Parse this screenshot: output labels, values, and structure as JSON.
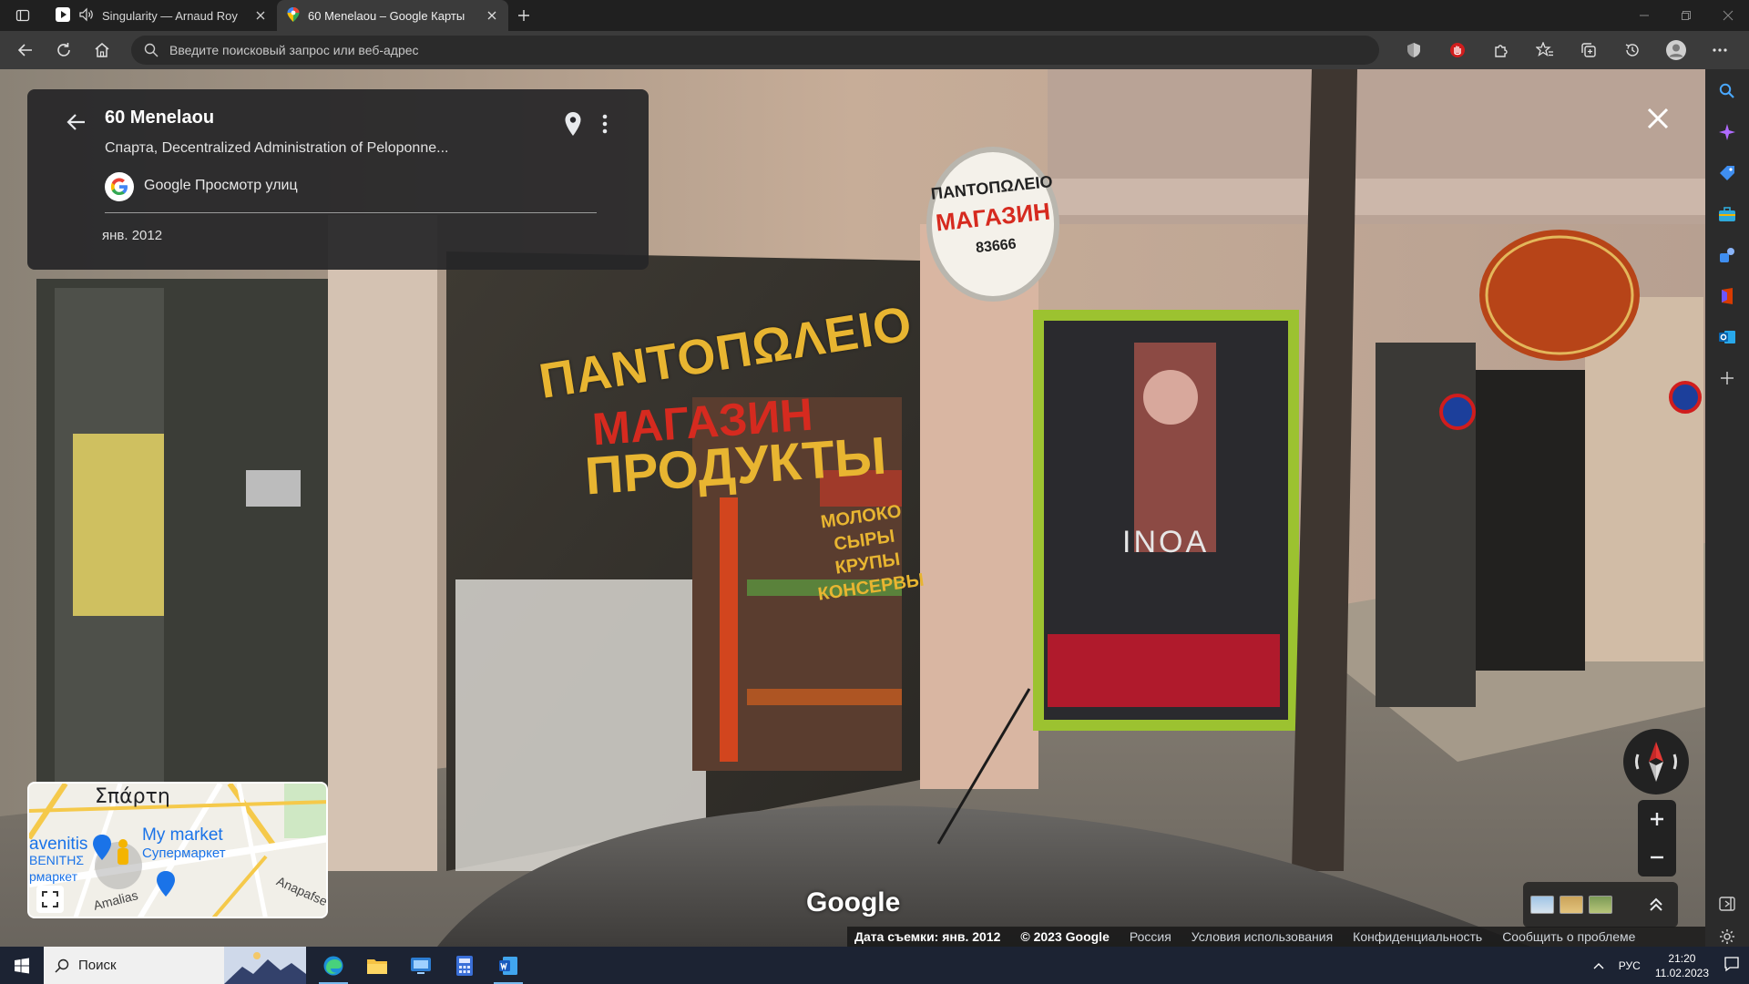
{
  "browser": {
    "tabs": [
      {
        "title": "Singularity — Arnaud Roy",
        "icon": "youtube-music-icon",
        "audio": true,
        "active": false
      },
      {
        "title": "60 Menelaou – Google Карты",
        "icon": "google-maps-icon",
        "audio": false,
        "active": true
      }
    ],
    "address_placeholder": "Введите поисковый запрос или веб-адрес"
  },
  "street_view": {
    "place_title": "60 Menelaou",
    "place_subtitle": "Спарта, Decentralized Administration of Peloponne...",
    "source_label": "Google Просмотр улиц",
    "capture_date": "янв. 2012",
    "watermark": "Google",
    "footer": {
      "capture": "Дата съемки: янв. 2012",
      "copyright": "© 2023 Google",
      "links": [
        "Россия",
        "Условия использования",
        "Конфиденциальность",
        "Сообщить о проблеме"
      ]
    },
    "minimap": {
      "city": "Σπάρτη",
      "poi": "My market",
      "poi_sub": "Супермаркет",
      "poi_left": "avenitis",
      "poi_left2": "ΒΕΝΙΤΗΣ",
      "poi_left3": "рмаркет",
      "street1": "Amalias",
      "street2": "Anapafse"
    },
    "signs": {
      "window_line1": "ΠΑΝΤΟΠΩΛΕΙΟ",
      "window_line2": "МАГАЗИН",
      "window_line3": "ПРОДУКТЫ",
      "side_line1": "МОЛОКО",
      "side_line2": "СЫРЫ",
      "side_line3": "КРУПЫ",
      "side_line4": "КОНСЕРВЫ",
      "oval_line1": "ΠΑΝΤΟΠΩΛΕΙΟ",
      "oval_line2": "МАГАЗИН",
      "oval_line3": "83666",
      "salon_brand": "INOA"
    }
  },
  "taskbar": {
    "search_label": "Поиск",
    "language": "РУС",
    "time": "21:20",
    "date": "11.02.2023"
  },
  "colors": {
    "accent_blue": "#1a73e8",
    "card_bg": "#262628",
    "sign_yellow": "#e8b531",
    "sign_red": "#d62a1f"
  }
}
